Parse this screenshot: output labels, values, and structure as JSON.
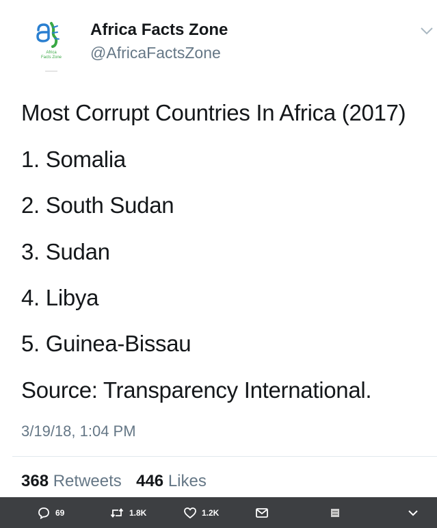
{
  "author": {
    "display_name": "Africa Facts Zone",
    "handle": "@AfricaFactsZone",
    "avatar_icon": "africa-facts-zone-logo",
    "avatar_text": "Africa Facts Zone"
  },
  "tweet": {
    "lines": [
      "Most Corrupt Countries In Africa (2017)",
      "1. Somalia",
      "2. South Sudan",
      "3. Sudan",
      "4. Libya",
      "5. Guinea-Bissau",
      "Source: Transparency International."
    ],
    "timestamp": "3/19/18, 1:04 PM"
  },
  "stats": {
    "retweets_count": "368",
    "retweets_label": "Retweets",
    "likes_count": "446",
    "likes_label": "Likes"
  },
  "actions": {
    "reply_count": "69",
    "retweet_count": "1.8K",
    "like_count": "1.2K"
  },
  "colors": {
    "text": "#14171a",
    "secondary": "#657786",
    "divider": "#e1e8ed",
    "action_bar": "#3d3f42",
    "logo_blue": "#2a7fd0",
    "logo_green": "#3aa845"
  },
  "icons": {
    "more": "chevron-down-icon",
    "reply": "reply-icon",
    "retweet": "retweet-icon",
    "like": "heart-icon",
    "message": "envelope-icon",
    "bookmark": "share-icon",
    "expand": "chevron-down-icon"
  }
}
